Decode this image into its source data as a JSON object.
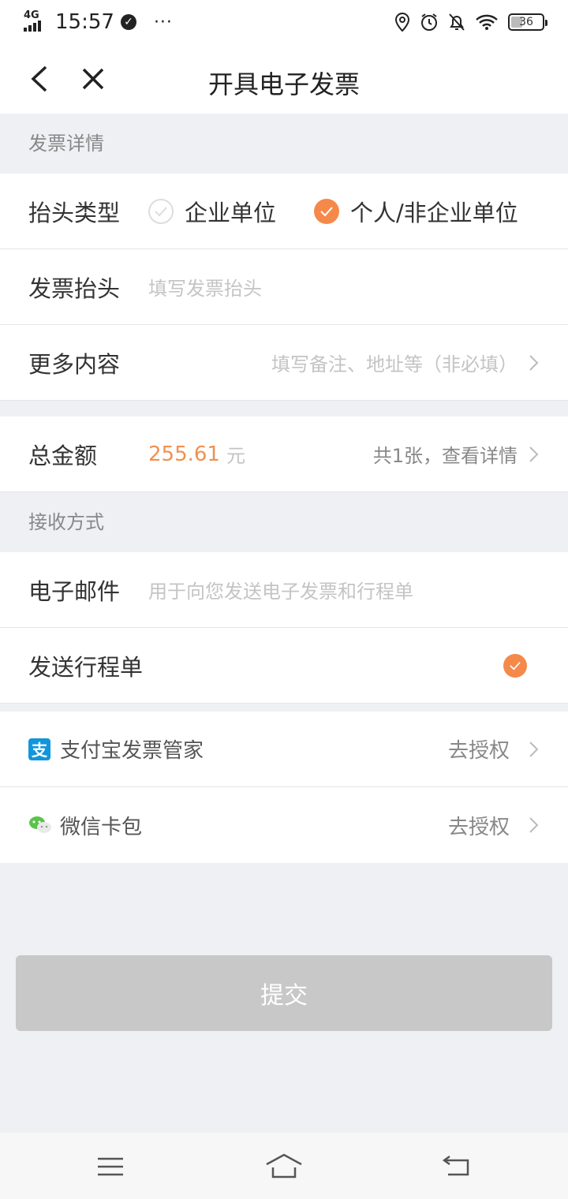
{
  "status_bar": {
    "network": "4G",
    "time": "15:57",
    "more": "···",
    "battery": "36"
  },
  "nav": {
    "title": "开具电子发票"
  },
  "invoice_details": {
    "header": "发票详情",
    "title_type": {
      "label": "抬头类型",
      "options": [
        {
          "label": "企业单位",
          "selected": false
        },
        {
          "label": "个人/非企业单位",
          "selected": true
        }
      ]
    },
    "invoice_title": {
      "label": "发票抬头",
      "placeholder": "填写发票抬头"
    },
    "more_content": {
      "label": "更多内容",
      "placeholder": "填写备注、地址等（非必填）"
    }
  },
  "total": {
    "label": "总金额",
    "amount": "255.61",
    "unit": "元",
    "detail": "共1张，查看详情"
  },
  "receive": {
    "header": "接收方式",
    "email": {
      "label": "电子邮件",
      "placeholder": "用于向您发送电子发票和行程单"
    },
    "send_itinerary": {
      "label": "发送行程单",
      "checked": true
    }
  },
  "integrations": [
    {
      "label": "支付宝发票管家",
      "action": "去授权",
      "icon": "alipay-icon"
    },
    {
      "label": "微信卡包",
      "action": "去授权",
      "icon": "wechat-icon"
    }
  ],
  "submit_label": "提交",
  "colors": {
    "accent": "#f5894a",
    "amount": "#f0914f",
    "disabled_button": "#c8c8c8",
    "background": "#eef0f3"
  }
}
